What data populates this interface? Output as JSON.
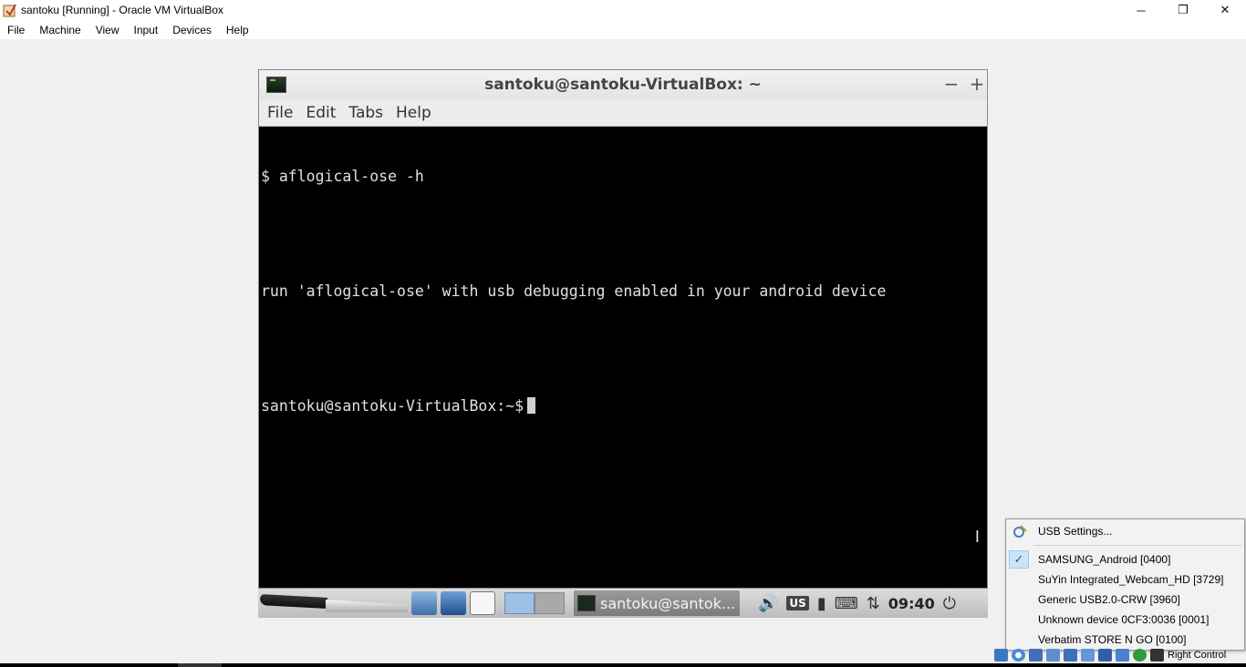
{
  "host": {
    "title": "santoku [Running] - Oracle VM VirtualBox",
    "menu": [
      "File",
      "Machine",
      "View",
      "Input",
      "Devices",
      "Help"
    ],
    "controls": {
      "minimize": "─",
      "restore": "❐",
      "close": "✕"
    }
  },
  "terminal": {
    "title": "santoku@santoku-VirtualBox: ~",
    "controls": {
      "minimize": "−",
      "maximize": "+"
    },
    "menu": [
      "File",
      "Edit",
      "Tabs",
      "Help"
    ],
    "lines": [
      "$ aflogical-ose -h",
      "",
      "run 'aflogical-ose' with usb debugging enabled in your android device",
      ""
    ],
    "prompt": "santoku@santoku-VirtualBox:~$",
    "ibeam": "I"
  },
  "guest_panel": {
    "task_label": "santoku@santok...",
    "tray": {
      "volume": "🔊",
      "keyboard_layout": "US",
      "battery": "▮",
      "keyboard": "⌨",
      "network": "⇅",
      "power": "⏻"
    },
    "clock": "09:40"
  },
  "usb_menu": {
    "settings_label": "USB Settings...",
    "devices": [
      {
        "label": "SAMSUNG_Android [0400]",
        "checked": true
      },
      {
        "label": "SuYin Integrated_Webcam_HD [3729]",
        "checked": false
      },
      {
        "label": "Generic USB2.0-CRW [3960]",
        "checked": false
      },
      {
        "label": "Unknown device 0CF3:0036 [0001]",
        "checked": false
      },
      {
        "label": "Verbatim STORE N GO [0100]",
        "checked": false
      }
    ],
    "check_mark": "✓"
  },
  "statusbar": {
    "host_key": "Right Control"
  },
  "colors": {
    "terminal_bg": "#000000",
    "terminal_fg": "#e0e0e0",
    "menu_highlight": "#cce4f7"
  }
}
